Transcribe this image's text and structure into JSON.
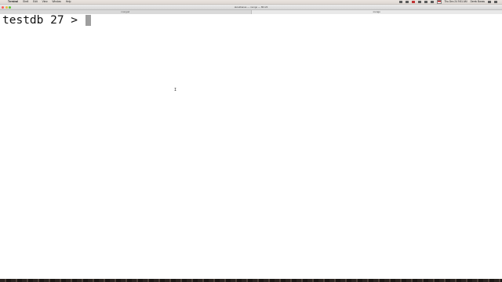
{
  "menubar": {
    "apple": "",
    "app_name": "Terminal",
    "items": [
      "Shell",
      "Edit",
      "View",
      "Window",
      "Help"
    ],
    "clock": "Thu Dec 24  9:51 AM",
    "user": "Derek Banas"
  },
  "window": {
    "title": "derekbanas — mongo — 80×23",
    "tabs": [
      {
        "label": "mongod",
        "active": false
      },
      {
        "label": "mongo",
        "active": true
      }
    ]
  },
  "terminal": {
    "prompt": "testdb 27 > "
  }
}
